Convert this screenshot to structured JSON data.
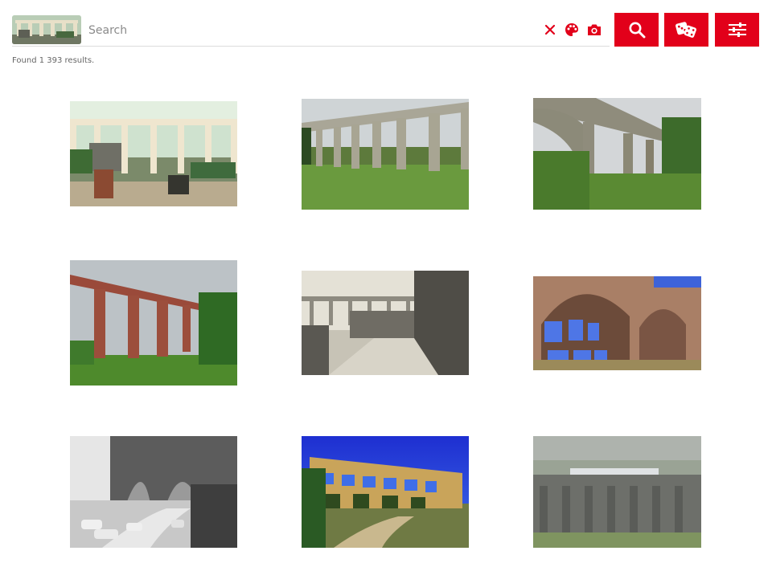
{
  "search": {
    "placeholder": "Search",
    "value": ""
  },
  "toolbar": {
    "clear_icon": "close-icon",
    "color_icon": "palette-icon",
    "camera_icon": "camera-icon",
    "search_icon": "search-icon",
    "random_icon": "dice-icon",
    "filter_icon": "sliders-icon"
  },
  "results": {
    "summary": "Found 1 393 results."
  },
  "theme": {
    "accent": "#e2001a"
  }
}
